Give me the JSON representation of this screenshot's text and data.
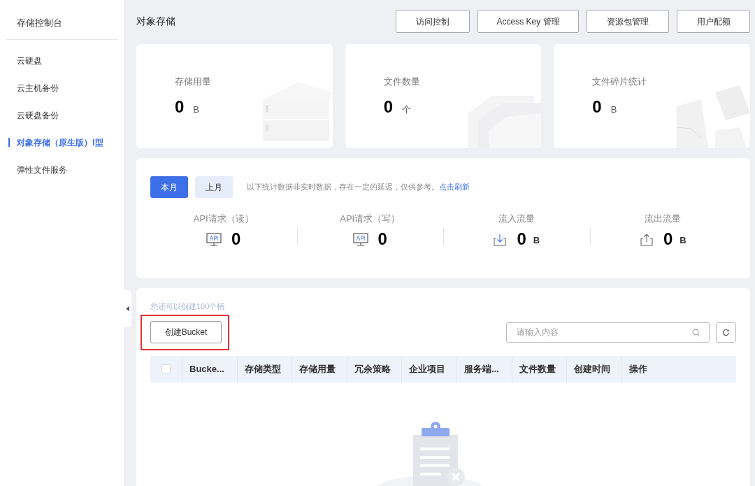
{
  "sidebar": {
    "title": "存储控制台",
    "items": [
      {
        "label": "云硬盘",
        "selected": false
      },
      {
        "label": "云主机备份",
        "selected": false
      },
      {
        "label": "云硬盘备份",
        "selected": false
      },
      {
        "label": "对象存储（原生版）Ⅰ型",
        "selected": true
      },
      {
        "label": "弹性文件服务",
        "selected": false
      }
    ]
  },
  "header": {
    "title": "对象存储",
    "buttons": [
      "访问控制",
      "Access Key 管理",
      "资源包管理",
      "用户配额"
    ]
  },
  "summary_cards": [
    {
      "kind": "server",
      "label": "存储用量",
      "value": "0",
      "unit": "B"
    },
    {
      "kind": "files",
      "label": "文件数量",
      "value": "0",
      "unit": "个"
    },
    {
      "kind": "fragments",
      "label": "文件碎片统计",
      "value": "0",
      "unit": "B"
    }
  ],
  "traffic": {
    "periods": [
      {
        "label": "本月",
        "selected": true
      },
      {
        "label": "上月",
        "selected": false
      }
    ],
    "note": "以下统计数据非实时数据，存在一定的延迟，仅供参考。",
    "refresh_link": "点击刷新",
    "metrics": [
      {
        "kind": "api",
        "icon_text": "API",
        "label": "API请求（读）",
        "value": "0"
      },
      {
        "kind": "api",
        "icon_text": "API",
        "label": "API请求（写）",
        "value": "0"
      },
      {
        "kind": "download",
        "label": "流入流量",
        "value": "0",
        "unit": "B"
      },
      {
        "kind": "upload",
        "label": "流出流量",
        "value": "0",
        "unit": "B"
      }
    ]
  },
  "buckets": {
    "quota_note": "您还可以创建100个桶",
    "create_button": "创建Bucket",
    "search": {
      "placeholder": "请输入内容"
    },
    "table": {
      "select_all": {
        "checked": false
      },
      "columns": [
        "Bucke...",
        "存储类型",
        "存储用量",
        "冗余策略",
        "企业项目",
        "服务端...",
        "文件数量",
        "创建时间",
        "操作"
      ]
    }
  }
}
